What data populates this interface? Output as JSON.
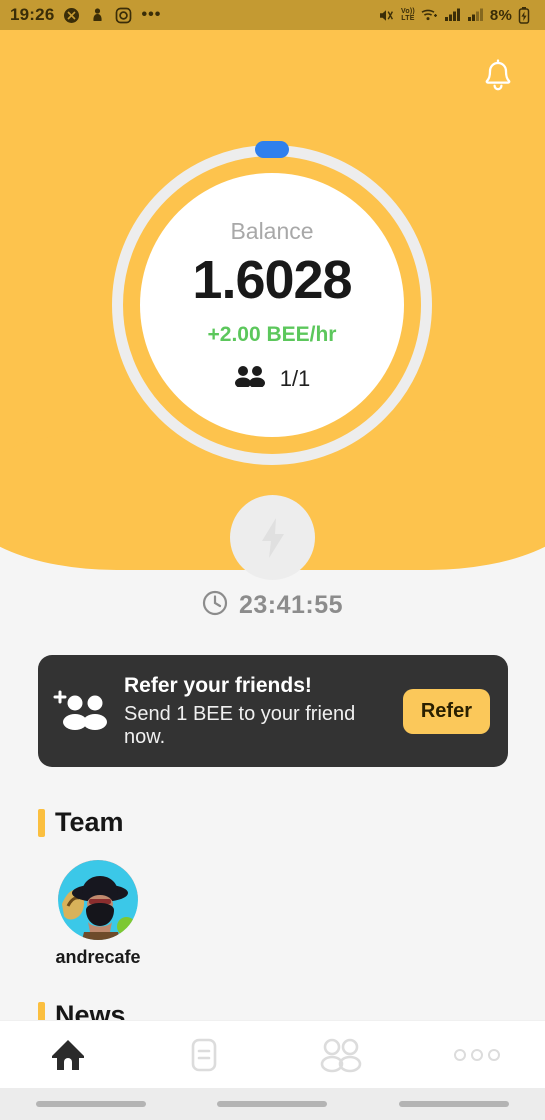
{
  "status_bar": {
    "time": "19:26",
    "left_icons": [
      "app-notification-icon",
      "app-notification-icon-2",
      "instagram-icon"
    ],
    "overflow": "•••",
    "mute_icon": "mute-icon",
    "network_label": "Vo)) LTE",
    "network_line1": "Vo))",
    "network_line2": "LTE",
    "wifi_icon": "wifi-icon",
    "signal_icon_1": "signal-bars-icon",
    "signal_icon_2": "signal-bars-icon-2",
    "battery_percent": "8%",
    "battery_icon": "battery-charging-icon",
    "bg_color": "#C49A32"
  },
  "header": {
    "bell_icon": "notification-bell-icon",
    "bg_color": "#FDC34D"
  },
  "balance_card": {
    "label": "Balance",
    "value": "1.6028",
    "rate": "+2.00 BEE/hr",
    "rate_color": "#5CC75C",
    "members_icon": "people-icon",
    "members_count": "1/1",
    "ring_track_color": "#EDEDED",
    "progress_dot_color": "#2F80ED"
  },
  "mine_button": {
    "icon": "lightning-bolt-icon",
    "state": "disabled",
    "bg_color": "#EDEDED"
  },
  "timer": {
    "clock_icon": "clock-icon",
    "value": "23:41:55",
    "color": "#8C8C8C"
  },
  "refer_card": {
    "icon": "add-people-icon",
    "title": "Refer your friends!",
    "subtitle": "Send 1 BEE to your friend now.",
    "button_label": "Refer",
    "bg_color": "#333333",
    "button_color": "#FBC85A"
  },
  "team": {
    "title": "Team",
    "accent_color": "#FBBF3F",
    "members": [
      {
        "name": "andrecafe",
        "avatar": "user-avatar-andrecafe",
        "status": "online",
        "status_color": "#7DC832"
      }
    ]
  },
  "news": {
    "title": "News",
    "accent_color": "#FBBF3F"
  },
  "bottom_nav": {
    "items": [
      {
        "name": "home",
        "icon": "home-icon",
        "active": true
      },
      {
        "name": "tasks",
        "icon": "document-icon",
        "active": false
      },
      {
        "name": "team",
        "icon": "people-outline-icon",
        "active": false
      },
      {
        "name": "more",
        "icon": "more-dots-icon",
        "active": false
      }
    ],
    "active_color": "#2B2B2B",
    "inactive_color": "#DCDCDC"
  }
}
